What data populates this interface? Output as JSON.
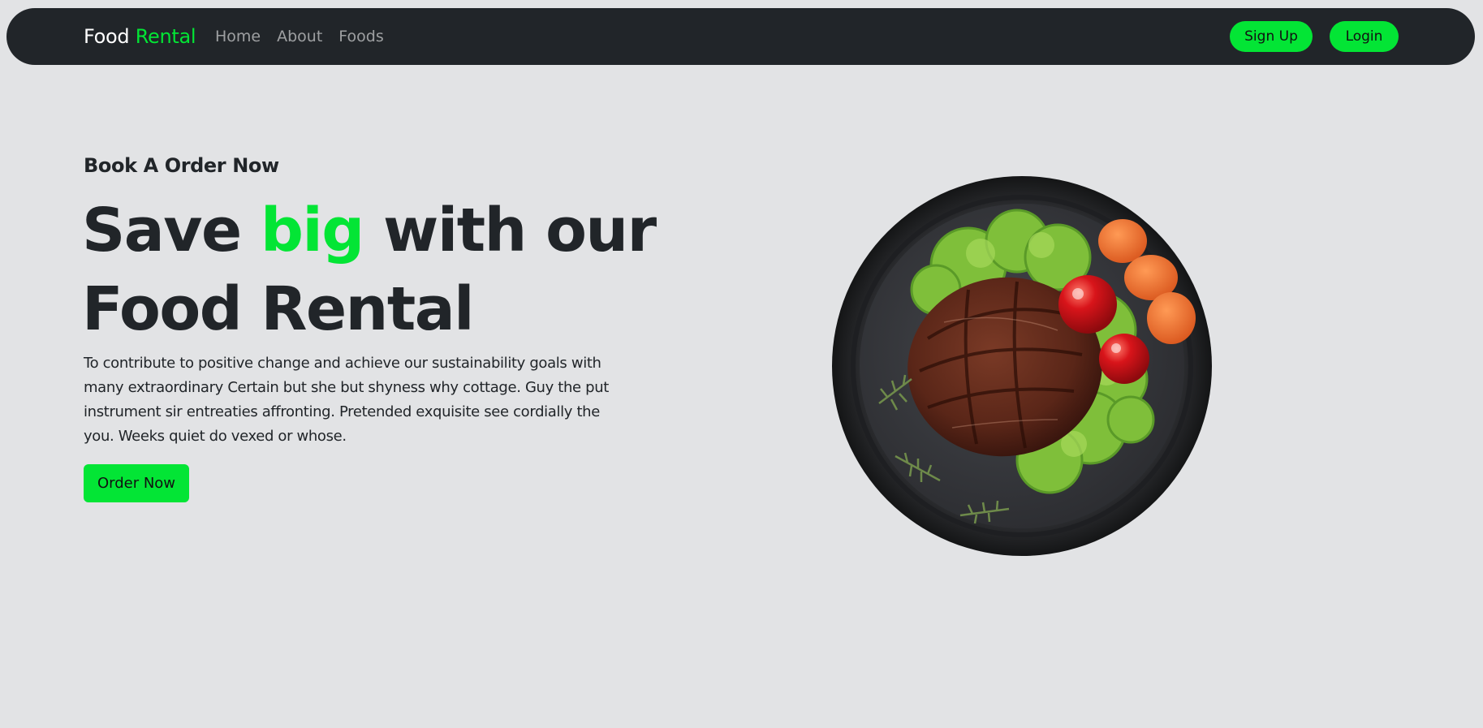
{
  "nav": {
    "brand_first": "Food",
    "brand_second": "Rental",
    "links": [
      "Home",
      "About",
      "Foods"
    ],
    "signup_label": "Sign Up",
    "login_label": "Login"
  },
  "hero": {
    "subtitle": "Book A Order Now",
    "title_part1": "Save",
    "title_accent": "big",
    "title_part2": "with our Food Rental",
    "description": "To contribute to positive change and achieve our sustainability goals with many extraordinary Certain but she but shyness why cottage. Guy the put instrument sir entreaties affronting. Pretended exquisite see cordially the you. Weeks quiet do vexed or whose.",
    "button_label": "Order Now"
  },
  "colors": {
    "accent": "#03e535",
    "navbar": "#212529",
    "background": "#e2e3e5"
  }
}
